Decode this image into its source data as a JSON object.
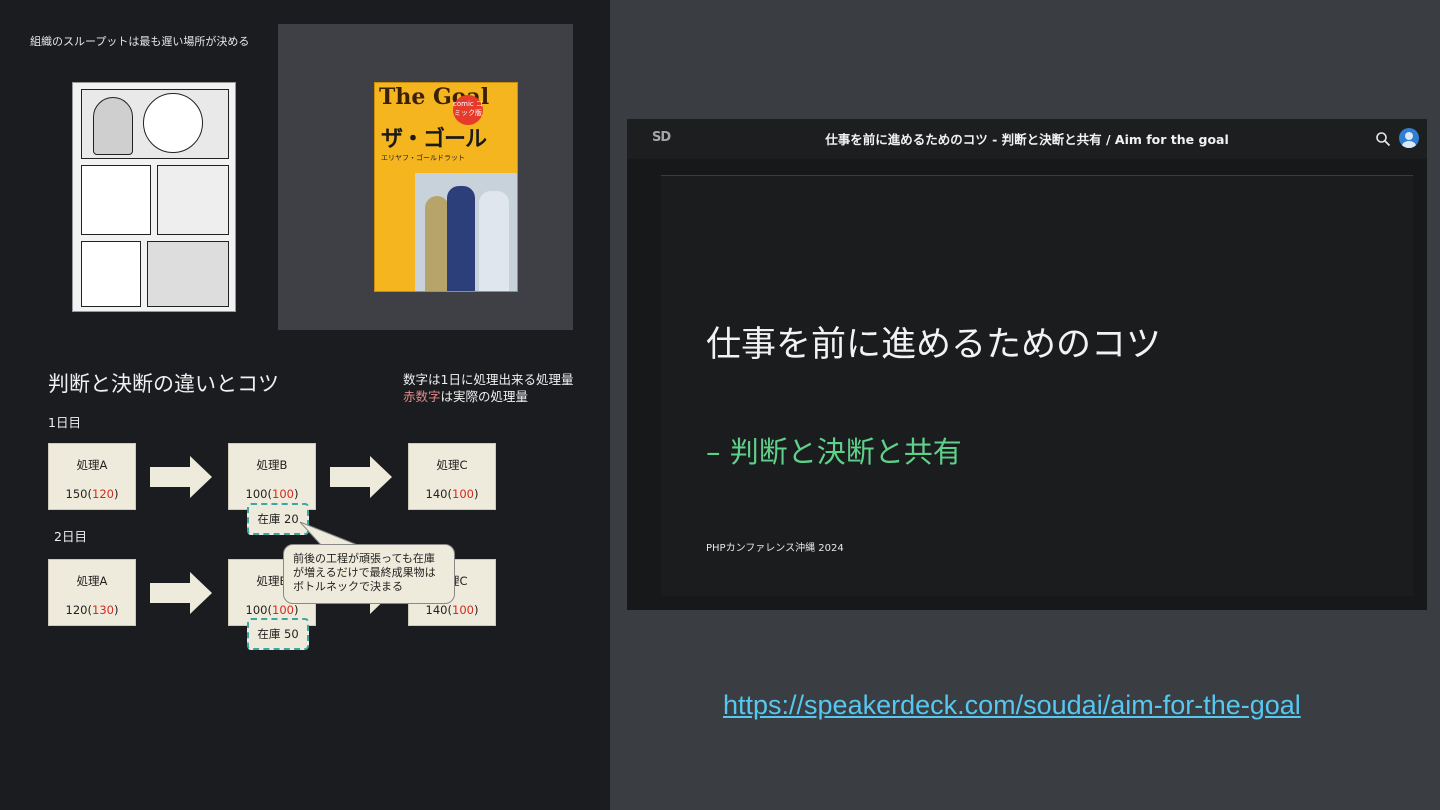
{
  "left_slide": {
    "caption": "組織のスループットは最も遅い場所が決める",
    "book": {
      "logo": "The Goal",
      "badge": "comic コミック版",
      "title": "ザ・ゴール",
      "author": "エリヤフ・ゴールドラット"
    },
    "heading": "判断と決断の違いとコツ",
    "note_line1": "数字は1日に処理出来る処理量",
    "note_red": "赤数字",
    "note_line2_rest": "は実際の処理量",
    "day1": {
      "label": "1日目",
      "processes": [
        {
          "name": "処理A",
          "plan": "150",
          "actual": "120"
        },
        {
          "name": "処理B",
          "plan": "100",
          "actual": "100"
        },
        {
          "name": "処理C",
          "plan": "140",
          "actual": "100"
        }
      ],
      "stock": "在庫 20"
    },
    "day2": {
      "label": "2日目",
      "processes": [
        {
          "name": "処理A",
          "plan": "120",
          "actual": "130"
        },
        {
          "name": "処理B",
          "plan": "100",
          "actual": "100"
        },
        {
          "name": "処理C",
          "plan": "140",
          "actual": "100"
        }
      ],
      "stock": "在庫 50"
    },
    "bubble": "前後の工程が頑張っても在庫が増えるだけで最終成果物はボトルネックで決まる"
  },
  "viewer": {
    "logo": "SD",
    "title": "仕事を前に進めるためのコツ - 判断と決断と共有 / Aim for the goal",
    "icons": [
      "search-icon",
      "avatar-icon"
    ],
    "slide_title": "仕事を前に進めるためのコツ",
    "slide_subtitle": "– 判断と決断と共有",
    "conference": "PHPカンファレンス沖縄 2024"
  },
  "link": "https://speakerdeck.com/soudai/aim-for-the-goal",
  "colors": {
    "accent_green": "#5fd08a",
    "link": "#56c7f0",
    "red_value": "#d42a1d",
    "stock_border": "#3aa7a3"
  }
}
